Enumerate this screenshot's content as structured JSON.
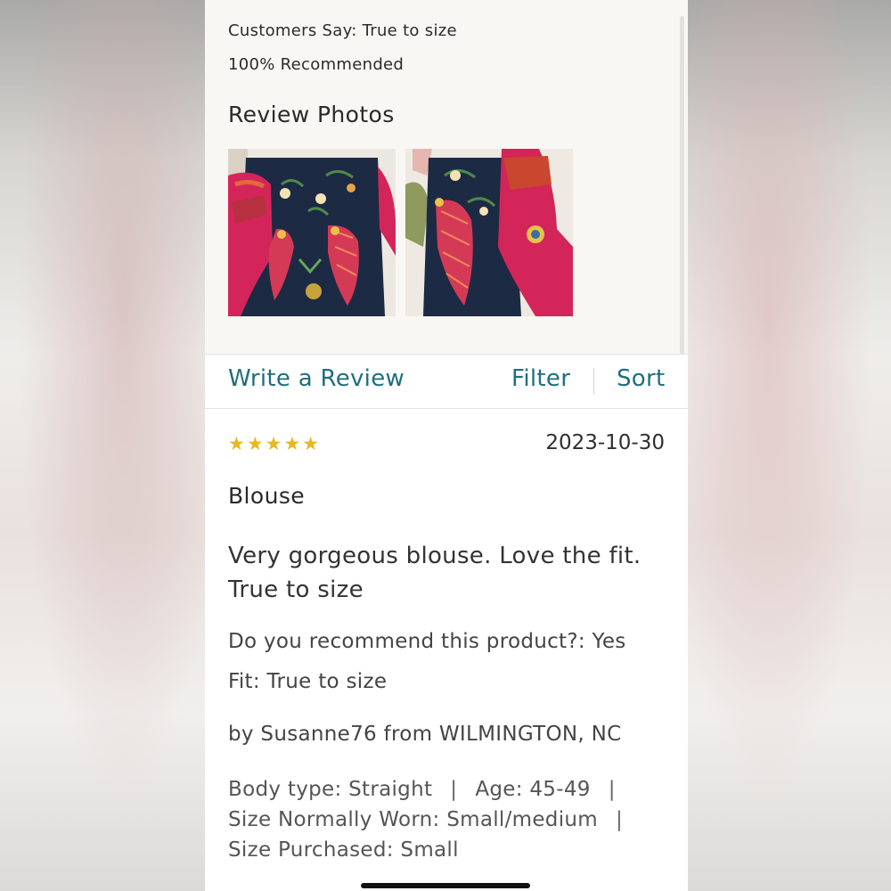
{
  "summary": {
    "customers_say": "Customers Say: True to size",
    "recommended": "100% Recommended",
    "photos_heading": "Review Photos"
  },
  "actions": {
    "write_review": "Write a Review",
    "filter": "Filter",
    "sort": "Sort"
  },
  "review": {
    "rating": 5,
    "stars": "★★★★★",
    "date": "2023-10-30",
    "title": "Blouse",
    "body": "Very gorgeous blouse. Love the fit. True to size",
    "recommend": "Do you recommend this product?: Yes",
    "fit": "Fit: True to size",
    "author": "by Susanne76 from WILMINGTON, NC",
    "body_type": "Body type: Straight",
    "age": "Age: 45-49",
    "size_worn": "Size Normally Worn: Small/medium",
    "size_purchased": "Size Purchased: Small"
  },
  "colors": {
    "accent": "#1e6f7e",
    "star": "#e8b820",
    "summary_bg": "#f8f7f3"
  }
}
